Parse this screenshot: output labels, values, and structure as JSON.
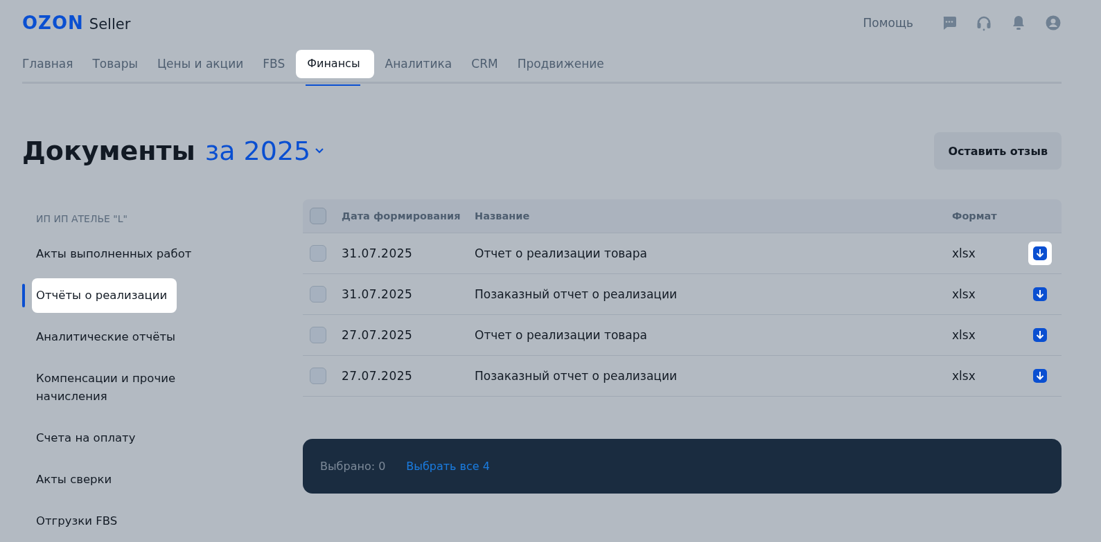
{
  "header": {
    "logo": "OZON",
    "logo_suffix": "Seller",
    "help": "Помощь"
  },
  "tabs": [
    {
      "label": "Главная",
      "selected": false,
      "highlighted": false
    },
    {
      "label": "Товары",
      "selected": false,
      "highlighted": false
    },
    {
      "label": "Цены и акции",
      "selected": false,
      "highlighted": false
    },
    {
      "label": "FBS",
      "selected": false,
      "highlighted": false
    },
    {
      "label": "Финансы",
      "selected": true,
      "highlighted": true
    },
    {
      "label": "Аналитика",
      "selected": false,
      "highlighted": false
    },
    {
      "label": "CRM",
      "selected": false,
      "highlighted": false
    },
    {
      "label": "Продвижение",
      "selected": false,
      "highlighted": false
    }
  ],
  "page": {
    "title": "Документы",
    "period": "за 2025",
    "feedback_button": "Оставить отзыв"
  },
  "sidebar": {
    "heading": "ИП ИП АТЕЛЬЕ \"L\"",
    "items": [
      {
        "label": "Акты выполненных работ",
        "selected": false,
        "highlighted": false
      },
      {
        "label": "Отчёты о реализации",
        "selected": true,
        "highlighted": true
      },
      {
        "label": "Аналитические отчёты",
        "selected": false,
        "highlighted": false
      },
      {
        "label": "Компенсации и прочие начисления",
        "selected": false,
        "highlighted": false
      },
      {
        "label": "Счета на оплату",
        "selected": false,
        "highlighted": false
      },
      {
        "label": "Акты сверки",
        "selected": false,
        "highlighted": false
      },
      {
        "label": "Отгрузки FBS",
        "selected": false,
        "highlighted": false
      }
    ]
  },
  "table": {
    "all_checked": false,
    "columns": [
      "Дата формирования",
      "Название",
      "Формат"
    ],
    "rows": [
      {
        "date": "31.07.2025",
        "name": "Отчет о реализации товара",
        "format": "xlsx",
        "checked": false,
        "download_highlighted": true
      },
      {
        "date": "31.07.2025",
        "name": "Позаказный отчет о реализации",
        "format": "xlsx",
        "checked": false,
        "download_highlighted": false
      },
      {
        "date": "27.07.2025",
        "name": "Отчет о реализации товара",
        "format": "xlsx",
        "checked": false,
        "download_highlighted": false
      },
      {
        "date": "27.07.2025",
        "name": "Позаказный отчет о реализации",
        "format": "xlsx",
        "checked": false,
        "download_highlighted": false
      }
    ]
  },
  "selection_bar": {
    "selected_text": "Выбрано: 0",
    "select_all": "Выбрать все 4"
  }
}
